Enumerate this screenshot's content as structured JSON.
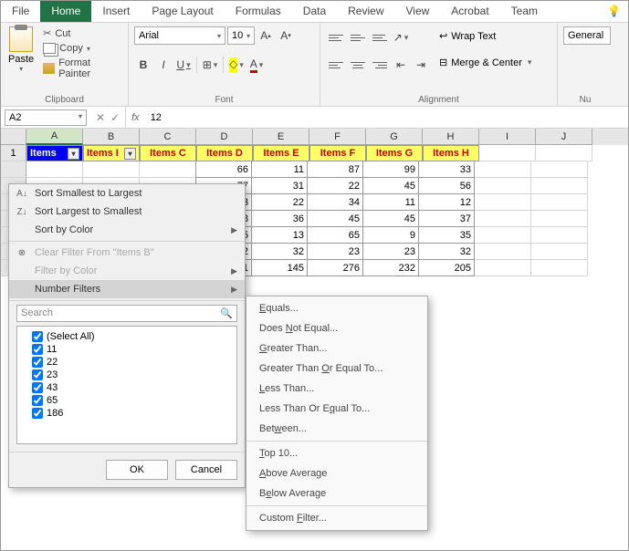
{
  "tabs": [
    "File",
    "Home",
    "Insert",
    "Page Layout",
    "Formulas",
    "Data",
    "Review",
    "View",
    "Acrobat",
    "Team"
  ],
  "active_tab": "Home",
  "clipboard": {
    "paste": "Paste",
    "cut": "Cut",
    "copy": "Copy",
    "fmt": "Format Painter",
    "label": "Clipboard"
  },
  "font": {
    "name": "Arial",
    "size": "10",
    "label": "Font",
    "b": "B",
    "i": "I",
    "u": "U",
    "a": "A"
  },
  "alignment": {
    "wrap": "Wrap Text",
    "merge": "Merge & Center",
    "label": "Alignment"
  },
  "number": {
    "fmt": "General",
    "label": "Nu"
  },
  "namebox": "A2",
  "formula": "12",
  "columns": [
    "A",
    "B",
    "C",
    "D",
    "E",
    "F",
    "G",
    "H",
    "I",
    "J"
  ],
  "headers": [
    "Items",
    "Items I",
    "Items C",
    "Items D",
    "Items E",
    "Items F",
    "Items G",
    "Items H"
  ],
  "chart_data": {
    "type": "table",
    "columns": [
      "Items D",
      "Items E",
      "Items F",
      "Items G",
      "Items H"
    ],
    "rows": [
      [
        66,
        11,
        87,
        99,
        33
      ],
      [
        77,
        31,
        22,
        45,
        56
      ],
      [
        23,
        22,
        34,
        11,
        12
      ],
      [
        88,
        36,
        45,
        45,
        37
      ],
      [
        65,
        13,
        65,
        9,
        35
      ],
      [
        22,
        32,
        23,
        23,
        32
      ],
      [
        41,
        145,
        276,
        232,
        205
      ]
    ]
  },
  "filter": {
    "sort_asc": "Sort Smallest to Largest",
    "sort_desc": "Sort Largest to Smallest",
    "sort_color": "Sort by Color",
    "clear": "Clear Filter From \"Items B\"",
    "by_color": "Filter by Color",
    "num_filters": "Number Filters",
    "search": "Search",
    "items": [
      "(Select All)",
      "11",
      "22",
      "23",
      "43",
      "65",
      "186"
    ],
    "ok": "OK",
    "cancel": "Cancel"
  },
  "submenu": [
    "Equals...",
    "Does Not Equal...",
    "Greater Than...",
    "Greater Than Or Equal To...",
    "Less Than...",
    "Less Than Or Equal To...",
    "Between...",
    "Top 10...",
    "Above Average",
    "Below Average",
    "Custom Filter..."
  ]
}
